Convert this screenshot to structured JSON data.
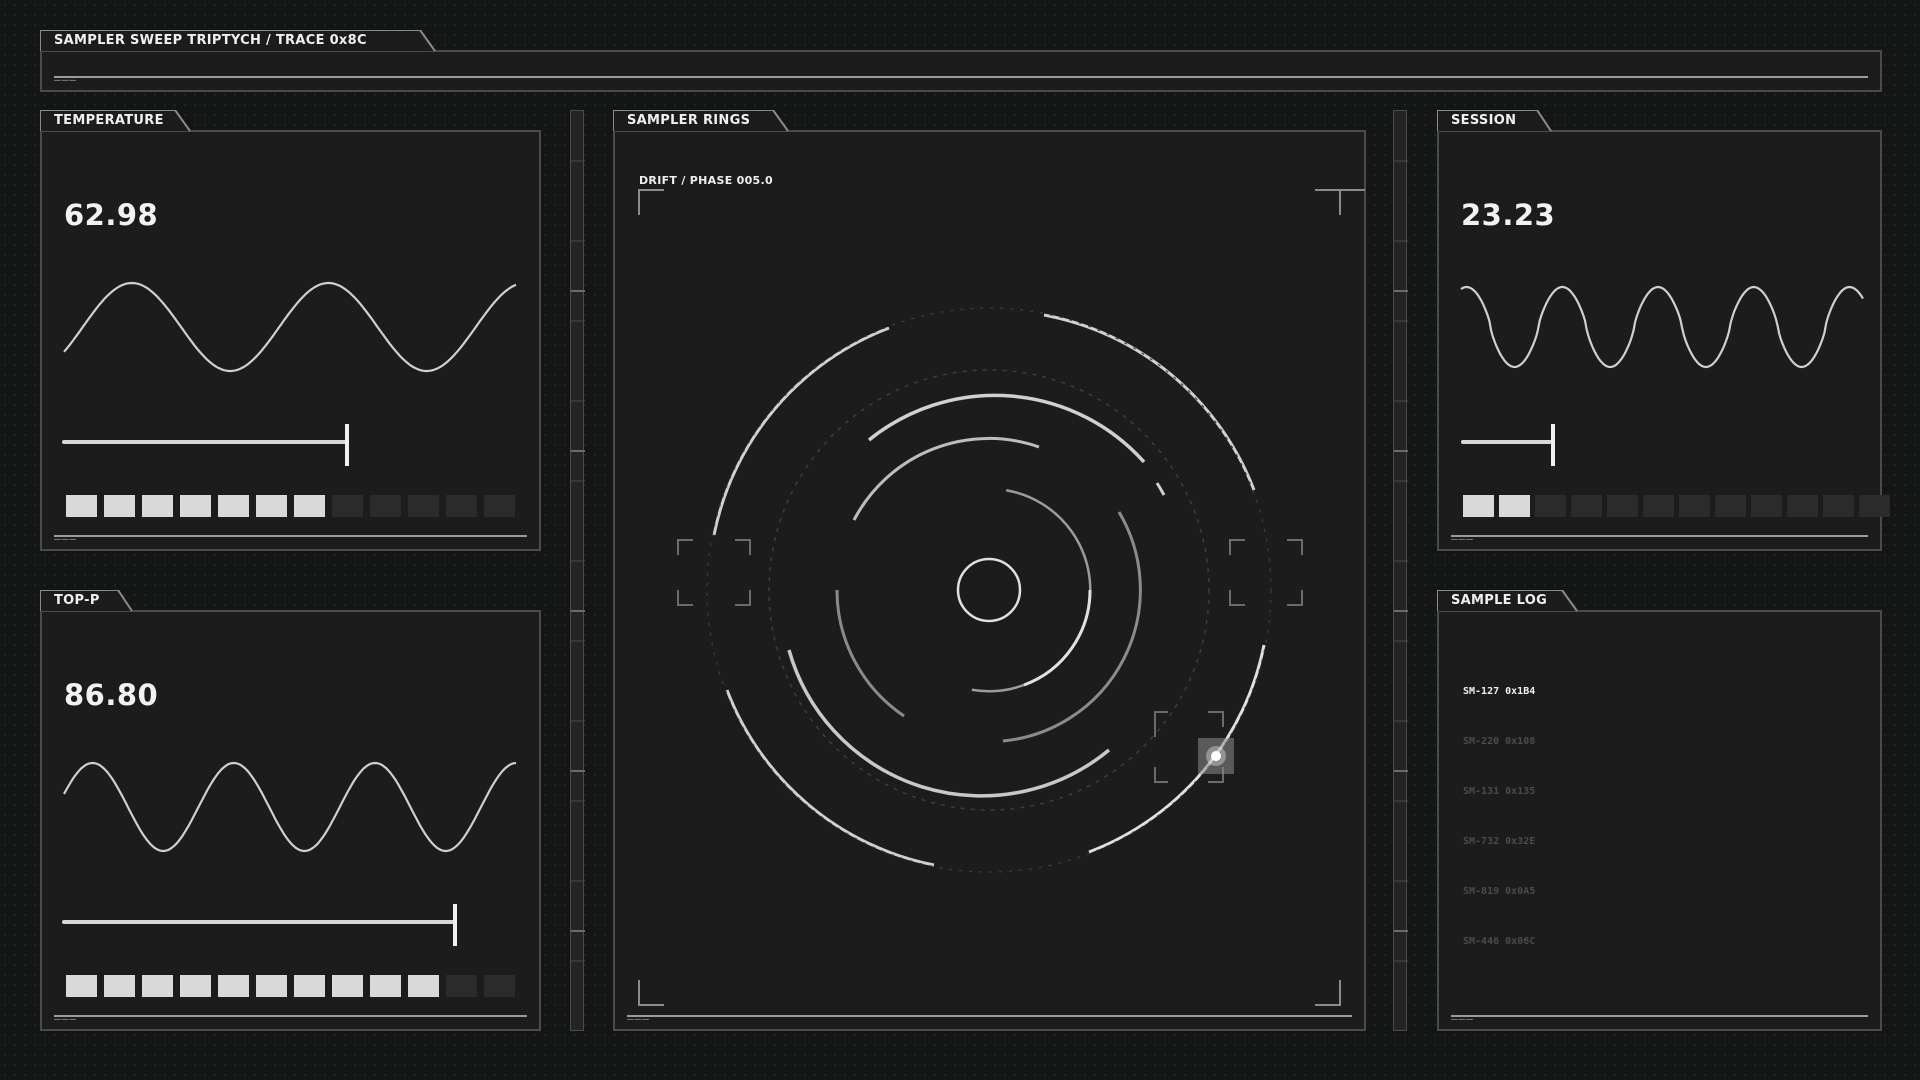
{
  "header": {
    "title": "SAMPLER SWEEP TRIPTYCH / TRACE 0x8C",
    "dashes": "———"
  },
  "temperature": {
    "title": "TEMPERATURE",
    "value": "62.98",
    "slider_fraction": 0.63,
    "segments_on": 7,
    "segments_total": 12,
    "dashes": "———"
  },
  "top_p": {
    "title": "TOP-P",
    "value": "86.80",
    "slider_fraction": 0.87,
    "segments_on": 10,
    "segments_total": 12,
    "dashes": "———"
  },
  "rings": {
    "title": "SAMPLER RINGS",
    "subtitle": "DRIFT / PHASE 005.0",
    "dashes": "———"
  },
  "session": {
    "title": "SESSION",
    "value": "23.23",
    "slider_fraction": 0.23,
    "segments_on": 2,
    "segments_total": 12,
    "dashes": "———"
  },
  "sample_log": {
    "title": "SAMPLE LOG",
    "items": [
      "SM-127 0x1B4",
      "SM-220 0x108",
      "SM-131 0x135",
      "SM-732 0x32E",
      "SM-819 0x0A5",
      "SM-446 0x06C"
    ],
    "dashes": "———"
  },
  "colors": {
    "background": "#141615",
    "panel": "#1b1c1b",
    "border": "#4a4c4b",
    "accent": "#d9d9d9"
  }
}
